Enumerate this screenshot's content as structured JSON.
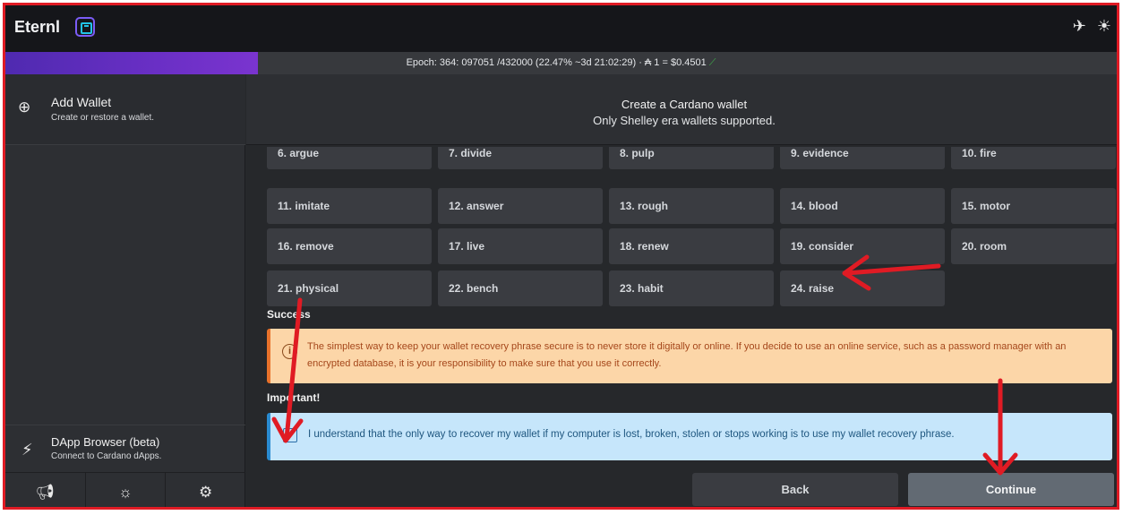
{
  "titlebar": {
    "app_name": "Eternl",
    "icons": [
      "satellite-icon",
      "sun-icon"
    ]
  },
  "epoch": {
    "text": "Epoch: 364: 097051 /432000 (22.47% ~3d 21:02:29) · ₳ 1 = $0.4501"
  },
  "sidebar": {
    "add_wallet": {
      "title": "Add Wallet",
      "subtitle": "Create or restore a wallet."
    },
    "dapp": {
      "title": "DApp Browser (beta)",
      "subtitle": "Connect to Cardano dApps."
    },
    "footer_icons": [
      "megaphone-icon",
      "bulb-icon",
      "settings-icon"
    ]
  },
  "main": {
    "title": "Create a Cardano wallet",
    "subtitle": "Only Shelley era wallets supported.",
    "words": [
      "6. argue",
      "7. divide",
      "8. pulp",
      "9. evidence",
      "10. fire",
      "11. imitate",
      "12. answer",
      "13. rough",
      "14. blood",
      "15. motor",
      "16. remove",
      "17. live",
      "18. renew",
      "19. consider",
      "20. room",
      "21. physical",
      "22. bench",
      "23. habit",
      "24. raise"
    ],
    "success_label": "Success",
    "warning_text": "The simplest way to keep your wallet recovery phrase secure is to never store it digitally or online. If you decide to use an online service, such as a password manager with an encrypted database, it is your responsibility to make sure that you use it correctly.",
    "important_label": "Important!",
    "ack_text": "I understand that the only way to recover my wallet if my computer is lost, broken, stolen or stops working is to use my wallet recovery phrase.",
    "ack_checked": true,
    "back_label": "Back",
    "continue_label": "Continue"
  },
  "colors": {
    "accent_purple": "#6a2fc5",
    "warning_bg": "#fcd6a8",
    "info_bg": "#c6e6fb",
    "annotation_red": "#e01b24"
  }
}
